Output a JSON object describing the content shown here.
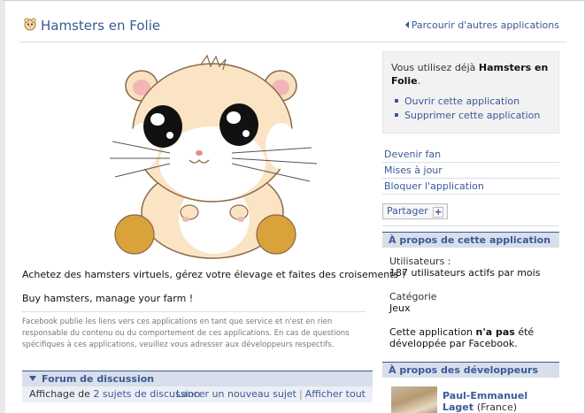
{
  "header": {
    "app_title": "Hamsters en Folie",
    "browse_link": "Parcourir d'autres applications"
  },
  "main": {
    "description_fr": "Achetez des hamsters virtuels, gérez votre élevage et faites des croisements !",
    "description_en": "Buy hamsters, manage your farm !",
    "disclaimer": "Facebook publie les liens vers ces applications en tant que service et n'est en rien responsable du contenu ou du comportement de ces applications. En cas de questions spécifiques à ces applications, veuillez vous adresser aux développeurs respectifs."
  },
  "forum": {
    "title": "Forum de discussion",
    "showing_prefix": "Affichage de",
    "showing_link": "2 sujets de discussion",
    "new_topic": "Lancer un nouveau sujet",
    "separator": "|",
    "show_all": "Afficher tout"
  },
  "sidebar": {
    "using_prefix": "Vous utilisez déjà",
    "using_app": "Hamsters en Folie",
    "using_suffix": ".",
    "open_app": "Ouvrir cette application",
    "remove_app": "Supprimer cette application",
    "become_fan": "Devenir fan",
    "updates": "Mises à jour",
    "block_app": "Bloquer l'application",
    "share": "Partager",
    "share_plus": "+"
  },
  "about_app": {
    "title": "À propos de cette application",
    "users_label": "Utilisateurs :",
    "users_value": "187 utilisateurs actifs par mois",
    "category_label": "Catégorie",
    "category_value": "Jeux",
    "dev_note_prefix": "Cette application",
    "dev_note_bold": "n'a pas",
    "dev_note_suffix": "été développée par Facebook."
  },
  "about_dev": {
    "title": "À propos des développeurs",
    "dev_name": "Paul-Emmanuel",
    "dev_surname": "Laget",
    "dev_country": "(France)"
  },
  "colors": {
    "link": "#3b5998",
    "section_bg": "#d8dfea",
    "info_bg": "#f2f2f2"
  }
}
